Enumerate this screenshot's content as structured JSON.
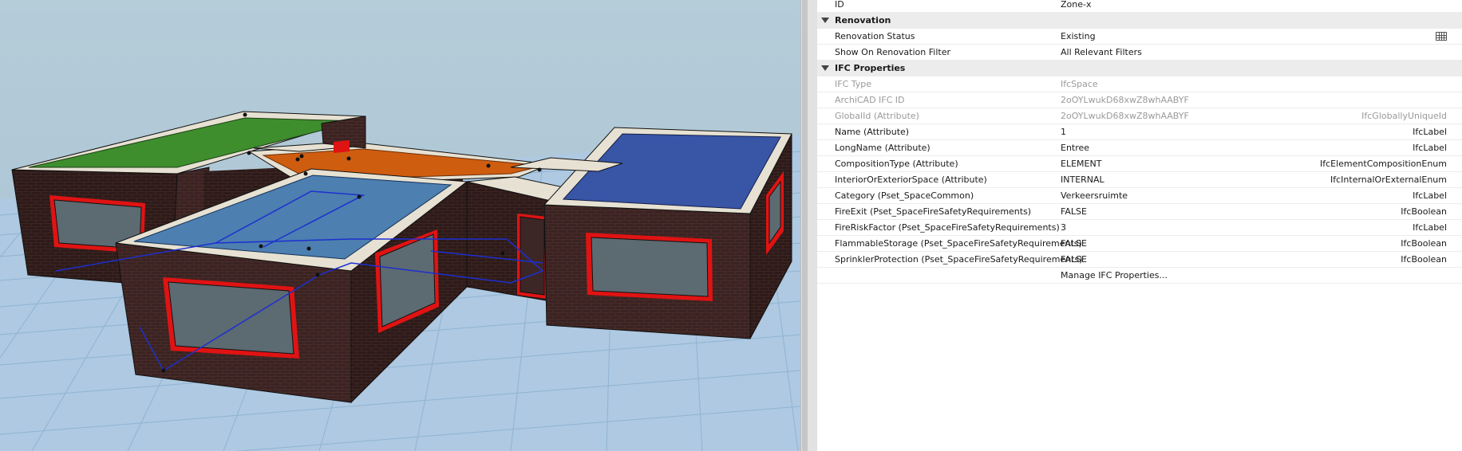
{
  "properties": {
    "top": {
      "label": "ID",
      "value": "Zone-x"
    },
    "renovation": {
      "title": "Renovation",
      "status": {
        "label": "Renovation Status",
        "value": "Existing"
      },
      "filter": {
        "label": "Show On Renovation Filter",
        "value": "All Relevant Filters"
      }
    },
    "ifc": {
      "title": "IFC Properties",
      "rows": [
        {
          "label": "IFC Type",
          "value": "IfcSpace",
          "type": "",
          "dim": true
        },
        {
          "label": "ArchiCAD IFC ID",
          "value": "2oOYLwukD68xwZ8whAABYF",
          "type": "",
          "dim": true
        },
        {
          "label": "GlobalId (Attribute)",
          "value": "2oOYLwukD68xwZ8whAABYF",
          "type": "IfcGloballyUniqueId",
          "dim": true
        },
        {
          "label": "Name (Attribute)",
          "value": "1",
          "type": "IfcLabel",
          "dim": false
        },
        {
          "label": "LongName (Attribute)",
          "value": "Entree",
          "type": "IfcLabel",
          "dim": false
        },
        {
          "label": "CompositionType (Attribute)",
          "value": "ELEMENT",
          "type": "IfcElementCompositionEnum",
          "dim": false
        },
        {
          "label": "InteriorOrExteriorSpace (Attribute)",
          "value": "INTERNAL",
          "type": "IfcInternalOrExternalEnum",
          "dim": false
        },
        {
          "label": "Category (Pset_SpaceCommon)",
          "value": "Verkeersruimte",
          "type": "IfcLabel",
          "dim": false
        },
        {
          "label": "FireExit (Pset_SpaceFireSafetyRequirements)",
          "value": "FALSE",
          "type": "IfcBoolean",
          "dim": false
        },
        {
          "label": "FireRiskFactor (Pset_SpaceFireSafetyRequirements)",
          "value": "3",
          "type": "IfcLabel",
          "dim": false
        },
        {
          "label": "FlammableStorage (Pset_SpaceFireSafetyRequirements)",
          "value": "FALSE",
          "type": "IfcBoolean",
          "dim": false
        },
        {
          "label": "SprinklerProtection (Pset_SpaceFireSafetyRequirements)",
          "value": "FALSE",
          "type": "IfcBoolean",
          "dim": false
        }
      ],
      "manage_label": "Manage IFC Properties..."
    }
  },
  "icons": {
    "group_expand": "triangle-down-icon",
    "renovation_status_picker": "grid-picker-icon"
  },
  "viewport": {
    "background": "#b4cbd8",
    "ground_color": "#aec9e1",
    "brick_color": "#3a2322",
    "roof_colors": {
      "green": "#3e8e2e",
      "orange": "#cf5d10",
      "blue": "#3855a6",
      "light_blue": "#4d7fb0"
    },
    "window_frame_color": "#e01313"
  }
}
